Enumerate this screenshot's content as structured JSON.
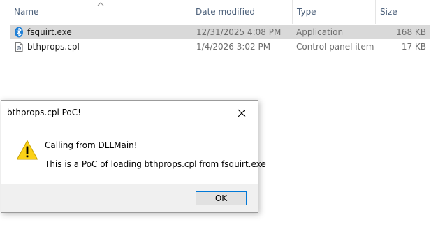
{
  "explorer": {
    "columns": {
      "name": "Name",
      "date_modified": "Date modified",
      "type": "Type",
      "size": "Size"
    },
    "files": [
      {
        "name": "fsquirt.exe",
        "date_modified": "12/31/2025 4:08 PM",
        "type": "Application",
        "size": "168 KB",
        "icon": "bluetooth-icon",
        "selected": true
      },
      {
        "name": "bthprops.cpl",
        "date_modified": "1/4/2026 3:02 PM",
        "type": "Control panel item",
        "size": "17 KB",
        "icon": "control-panel-file-icon",
        "selected": false
      }
    ]
  },
  "dialog": {
    "title": "bthprops.cpl PoC!",
    "icon": "warning-icon",
    "line1": "Calling from DLLMain!",
    "line2": "This is a PoC of loading bthprops.cpl from fsquirt.exe",
    "ok_label": "OK"
  },
  "colors": {
    "selection": "#d9d9d9",
    "header_text": "#4c607a",
    "accent": "#0078d7",
    "warning": "#fcd116"
  }
}
